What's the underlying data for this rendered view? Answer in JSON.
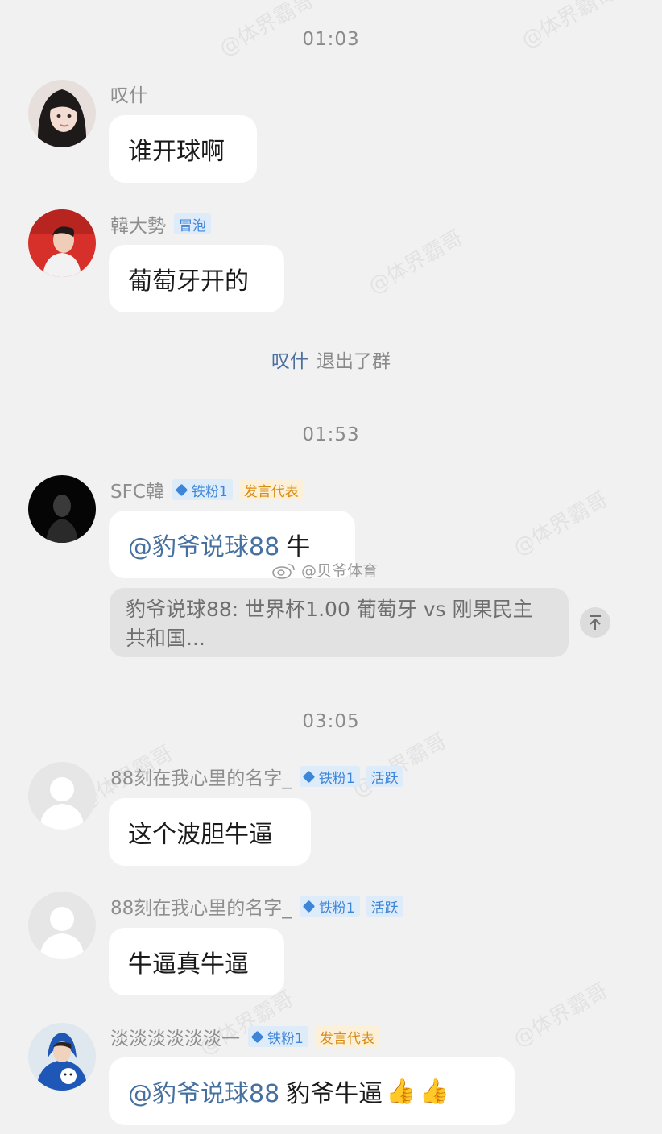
{
  "watermarks": [
    "@体界霸哥",
    "@体界霸哥",
    "@体界霸哥",
    "@体界霸哥",
    "@体界霸哥",
    "@体界霸哥",
    "@体界霸哥",
    "@体界霸哥"
  ],
  "weibo_watermark": "@贝爷体育",
  "timestamps": [
    "01:03",
    "01:53",
    "03:05"
  ],
  "system_message": {
    "name": "叹什",
    "text": "退出了群"
  },
  "messages": [
    {
      "name": "叹什",
      "text": "谁开球啊"
    },
    {
      "name": "韓大勢",
      "badge": "冒泡",
      "text": "葡萄牙开的"
    },
    {
      "name": "SFC韓",
      "fan_badge": "铁粉1",
      "role_badge": "发言代表",
      "mention": "@豹爷说球88",
      "text": "牛",
      "reply": "豹爷说球88: 世界杯1.00 葡萄牙 vs 刚果民主共和国..."
    },
    {
      "name": "88刻在我心里的名字_",
      "fan_badge": "铁粉1",
      "role_badge": "活跃",
      "text": "这个波胆牛逼"
    },
    {
      "name": "88刻在我心里的名字_",
      "fan_badge": "铁粉1",
      "role_badge": "活跃",
      "text": "牛逼真牛逼"
    },
    {
      "name": "淡淡淡淡淡淡一",
      "fan_badge": "铁粉1",
      "role_badge": "发言代表",
      "mention": "@豹爷说球88",
      "text": "豹爷牛逼"
    }
  ],
  "icons": {
    "scroll_top": "arrow-up-to-top-icon",
    "thumbs_up": "thumbs-up-emoji"
  },
  "colors": {
    "background": "#f1f1f1",
    "bubble": "#ffffff",
    "mention": "#46709f",
    "badge_blue": "#3d85d8",
    "badge_orange": "#d98b14"
  }
}
